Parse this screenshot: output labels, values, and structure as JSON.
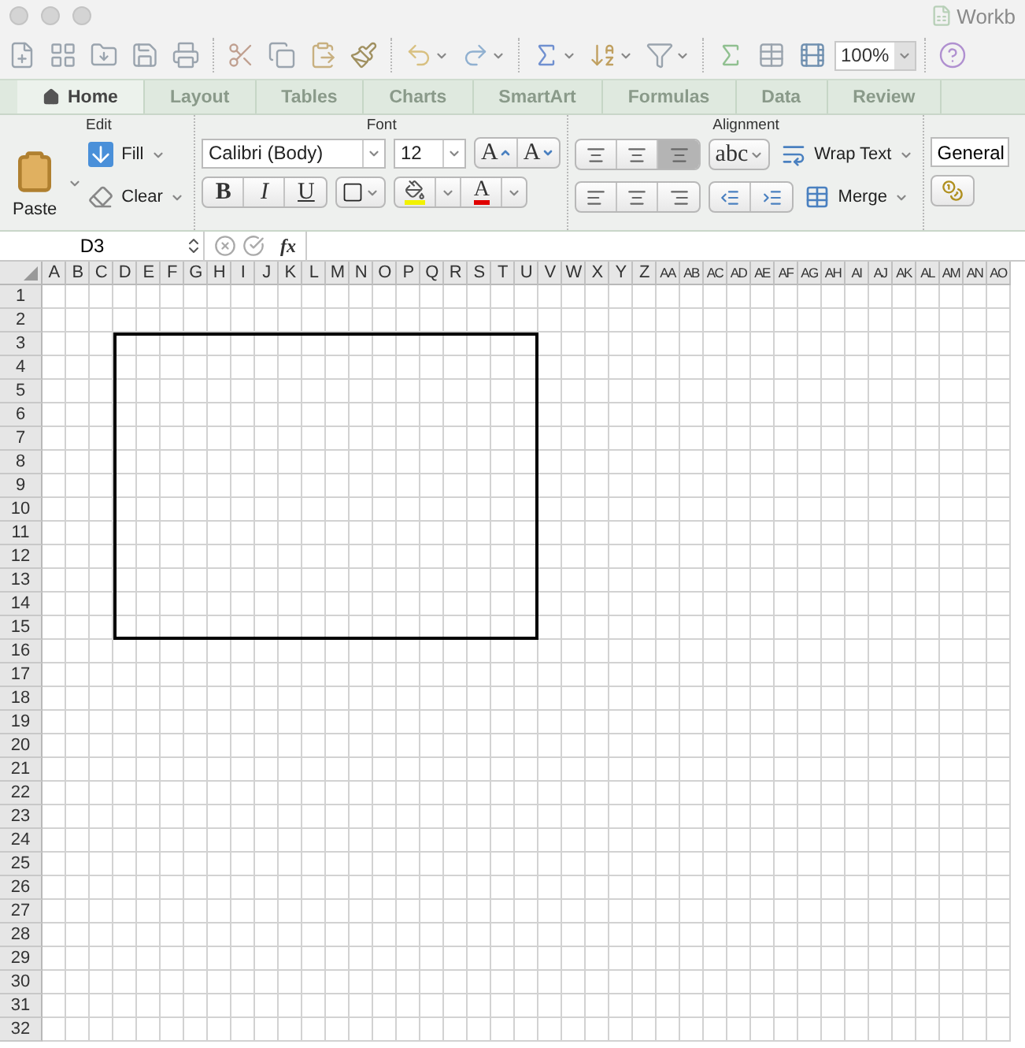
{
  "window": {
    "title": "Workb"
  },
  "toolbar": {
    "zoom": "100%"
  },
  "ribbon_tabs": [
    {
      "label": "Home",
      "selected": true
    },
    {
      "label": "Layout",
      "selected": false
    },
    {
      "label": "Tables",
      "selected": false
    },
    {
      "label": "Charts",
      "selected": false
    },
    {
      "label": "SmartArt",
      "selected": false
    },
    {
      "label": "Formulas",
      "selected": false
    },
    {
      "label": "Data",
      "selected": false
    },
    {
      "label": "Review",
      "selected": false
    }
  ],
  "ribbon": {
    "edit": {
      "title": "Edit",
      "paste": "Paste",
      "fill": "Fill",
      "clear": "Clear"
    },
    "font": {
      "title": "Font",
      "font_name": "Calibri (Body)",
      "font_size": "12",
      "grow": "A",
      "shrink": "A",
      "bold": "B",
      "italic": "I",
      "underline": "U",
      "font_color": "A"
    },
    "alignment": {
      "title": "Alignment",
      "vertical_align": [
        {
          "selected": false
        },
        {
          "selected": false
        },
        {
          "selected": true
        }
      ],
      "orientation": "abc",
      "wrap_text": "Wrap Text",
      "merge": "Merge"
    },
    "number": {
      "format": "General"
    }
  },
  "formula_bar": {
    "cell_reference": "D3",
    "fx": "fx"
  },
  "sheet": {
    "columns": [
      "A",
      "B",
      "C",
      "D",
      "E",
      "F",
      "G",
      "H",
      "I",
      "J",
      "K",
      "L",
      "M",
      "N",
      "O",
      "P",
      "Q",
      "R",
      "S",
      "T",
      "U",
      "V",
      "W",
      "X",
      "Y",
      "Z",
      "AA",
      "AB",
      "AC",
      "AD",
      "AE",
      "AF",
      "AG",
      "AH",
      "AI",
      "AJ",
      "AK",
      "AL",
      "AM",
      "AN",
      "AO"
    ],
    "rows": [
      "1",
      "2",
      "3",
      "4",
      "5",
      "6",
      "7",
      "8",
      "9",
      "10",
      "11",
      "12",
      "13",
      "14",
      "15",
      "16",
      "17",
      "18",
      "19",
      "20",
      "21",
      "22",
      "23",
      "24",
      "25",
      "26",
      "27",
      "28",
      "29",
      "30",
      "31",
      "32"
    ]
  }
}
